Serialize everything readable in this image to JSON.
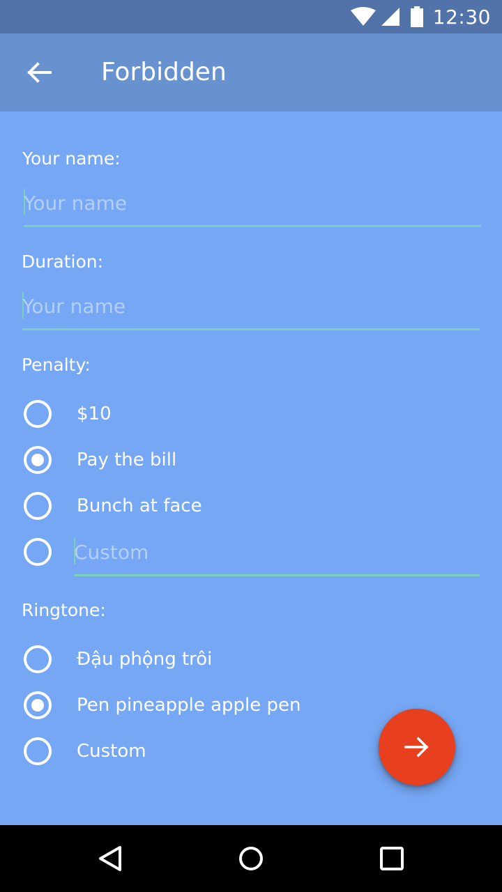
{
  "status_bar": {
    "time": "12:30",
    "icons": [
      "wifi-icon",
      "cell-signal-icon",
      "battery-icon"
    ]
  },
  "app_bar": {
    "back_icon": "arrow-back-icon",
    "title": "Forbidden"
  },
  "form": {
    "name": {
      "label": "Your name:",
      "value": "",
      "placeholder": "Your name"
    },
    "duration": {
      "label": "Duration:",
      "value": "",
      "placeholder": "Your name"
    },
    "penalty": {
      "label": "Penalty:",
      "options": [
        {
          "label": "$10",
          "checked": false
        },
        {
          "label": "Pay the bill",
          "checked": true
        },
        {
          "label": "Bunch at face",
          "checked": false
        }
      ],
      "custom": {
        "checked": false,
        "value": "",
        "placeholder": "Custom"
      }
    },
    "ringtone": {
      "label": "Ringtone:",
      "options": [
        {
          "label": "Đậu phộng trôi",
          "checked": false
        },
        {
          "label": "Pen pineapple apple pen",
          "checked": true
        },
        {
          "label": "Custom",
          "checked": false
        }
      ]
    }
  },
  "fab": {
    "icon": "arrow-forward-icon"
  },
  "nav_bar": {
    "buttons": [
      "back-triangle-icon",
      "home-circle-icon",
      "recents-square-icon"
    ]
  },
  "colors": {
    "status_bar": "#5273A9",
    "app_bar": "#6891CF",
    "background": "#76A7F4",
    "field_underline": "#7CCFB8",
    "placeholder": "#B4CFF6",
    "fab": "#E8401F",
    "nav_bar": "#000000"
  }
}
